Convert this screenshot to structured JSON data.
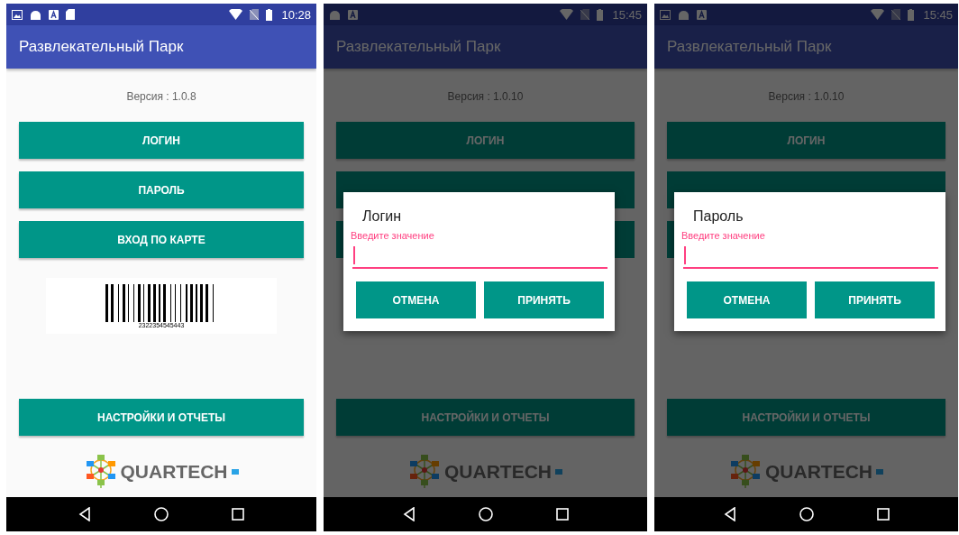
{
  "screens": [
    {
      "status_bar": {
        "notifications": [
          {
            "kind": "image"
          },
          {
            "kind": "android"
          },
          {
            "kind": "letter"
          },
          {
            "kind": "sd"
          }
        ],
        "time": "10:28"
      },
      "app_bar": {
        "title": "Развлекательный Парк"
      },
      "version": "Версия : 1.0.8",
      "buttons": [
        {
          "label": "ЛОГИН",
          "covered": false
        },
        {
          "label": "ПАРОЛЬ",
          "covered": false
        },
        {
          "label": "ВХОД ПО КАРТЕ",
          "covered": false
        }
      ],
      "barcode": {
        "number": "2322354545443"
      },
      "settings_button": "НАСТРОЙКИ И ОТЧЕТЫ",
      "logo": {
        "text": "QUARTECH"
      }
    },
    {
      "status_bar": {
        "notifications": [
          {
            "kind": "android"
          },
          {
            "kind": "letter"
          }
        ],
        "time": "15:45"
      },
      "app_bar": {
        "title": "Развлекательный Парк"
      },
      "version": "Версия : 1.0.10",
      "buttons": [
        {
          "label": "ЛОГИН",
          "covered": false
        },
        {
          "covered": true
        },
        {
          "covered": true
        }
      ],
      "settings_button": "НАСТРОЙКИ И ОТЧЕТЫ",
      "logo": {
        "text": "QUARTECH"
      },
      "dialog": {
        "title": "Логин",
        "field": {
          "label": "Введите значение",
          "focused": true
        },
        "buttons": [
          "ОТМЕНА",
          "ПРИНЯТЬ"
        ]
      }
    },
    {
      "status_bar": {
        "notifications": [
          {
            "kind": "image"
          },
          {
            "kind": "android"
          },
          {
            "kind": "letter"
          }
        ],
        "time": "15:45"
      },
      "app_bar": {
        "title": "Развлекательный Парк"
      },
      "version": "Версия : 1.0.10",
      "buttons": [
        {
          "label": "ЛОГИН",
          "covered": false
        },
        {
          "covered": true
        },
        {
          "covered": true
        }
      ],
      "settings_button": "НАСТРОЙКИ И ОТЧЕТЫ",
      "logo": {
        "text": "QUARTECH"
      },
      "dialog": {
        "title": "Пароль",
        "field": {
          "label": "Введите значение",
          "focused": true
        },
        "buttons": [
          "ОТМЕНА",
          "ПРИНЯТЬ"
        ]
      }
    }
  ]
}
